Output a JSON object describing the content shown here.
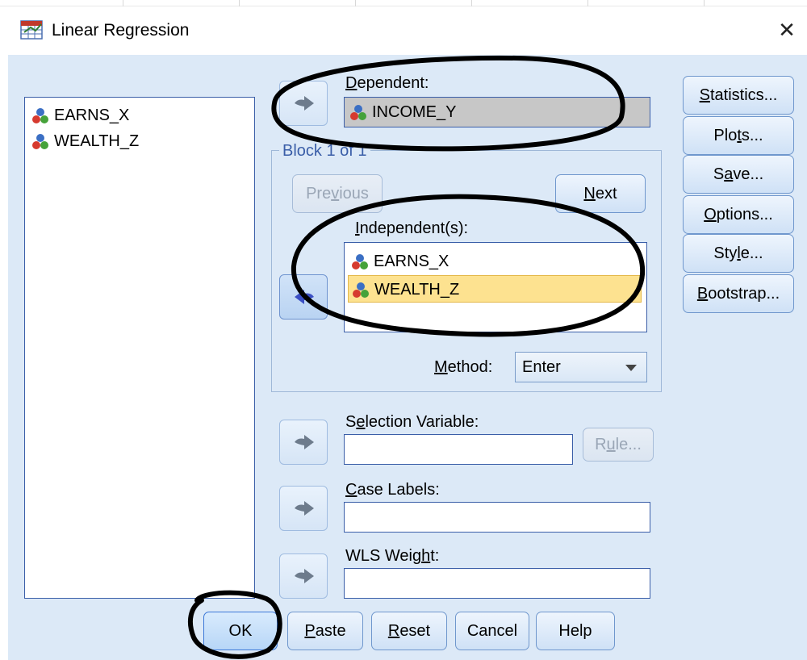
{
  "window": {
    "title": "Linear Regression",
    "close_glyph": "✕"
  },
  "source_list": {
    "items": [
      {
        "label": "EARNS_X",
        "icon": "nominal-variable-icon"
      },
      {
        "label": "WEALTH_Z",
        "icon": "nominal-variable-icon"
      }
    ]
  },
  "dependent": {
    "label": "Dependent:",
    "mnemonic": "D",
    "label_rest": "ependent:",
    "value": "INCOME_Y"
  },
  "block": {
    "title": "Block 1 of 1",
    "previous_pre": "Pre",
    "previous_m": "v",
    "previous_post": "ious",
    "next_m": "N",
    "next_post": "ext"
  },
  "independents": {
    "label_m": "I",
    "label_post": "ndependent(s):",
    "items": [
      {
        "label": "EARNS_X",
        "selected": false
      },
      {
        "label": "WEALTH_Z",
        "selected": true
      }
    ]
  },
  "method": {
    "label_m": "M",
    "label_post": "ethod:",
    "value": "Enter"
  },
  "selection_variable": {
    "label_pre": "S",
    "label_m": "e",
    "label_post": "lection Variable:",
    "value": "",
    "rule_pre": "R",
    "rule_m": "u",
    "rule_post": "le..."
  },
  "case_labels": {
    "label_m": "C",
    "label_post": "ase Labels:",
    "value": ""
  },
  "wls_weight": {
    "label_pre": "WLS Weig",
    "label_m": "h",
    "label_post": "t:",
    "value": ""
  },
  "side_buttons": {
    "statistics_m": "S",
    "statistics_post": "tatistics...",
    "plots_pre": "Plo",
    "plots_m": "t",
    "plots_post": "s...",
    "save_pre": "S",
    "save_m": "a",
    "save_post": "ve...",
    "options_m": "O",
    "options_post": "ptions...",
    "style_pre": "Sty",
    "style_m": "l",
    "style_post": "e...",
    "bootstrap_m": "B",
    "bootstrap_post": "ootstrap..."
  },
  "bottom_buttons": {
    "ok": "OK",
    "paste_m": "P",
    "paste_post": "aste",
    "reset_m": "R",
    "reset_post": "eset",
    "cancel": "Cancel",
    "help": "Help"
  },
  "colors": {
    "client_bg": "#dce9f7",
    "selection_highlight": "#fde290",
    "field_border": "#3a5ea8",
    "annotation_ink": "#000000"
  }
}
